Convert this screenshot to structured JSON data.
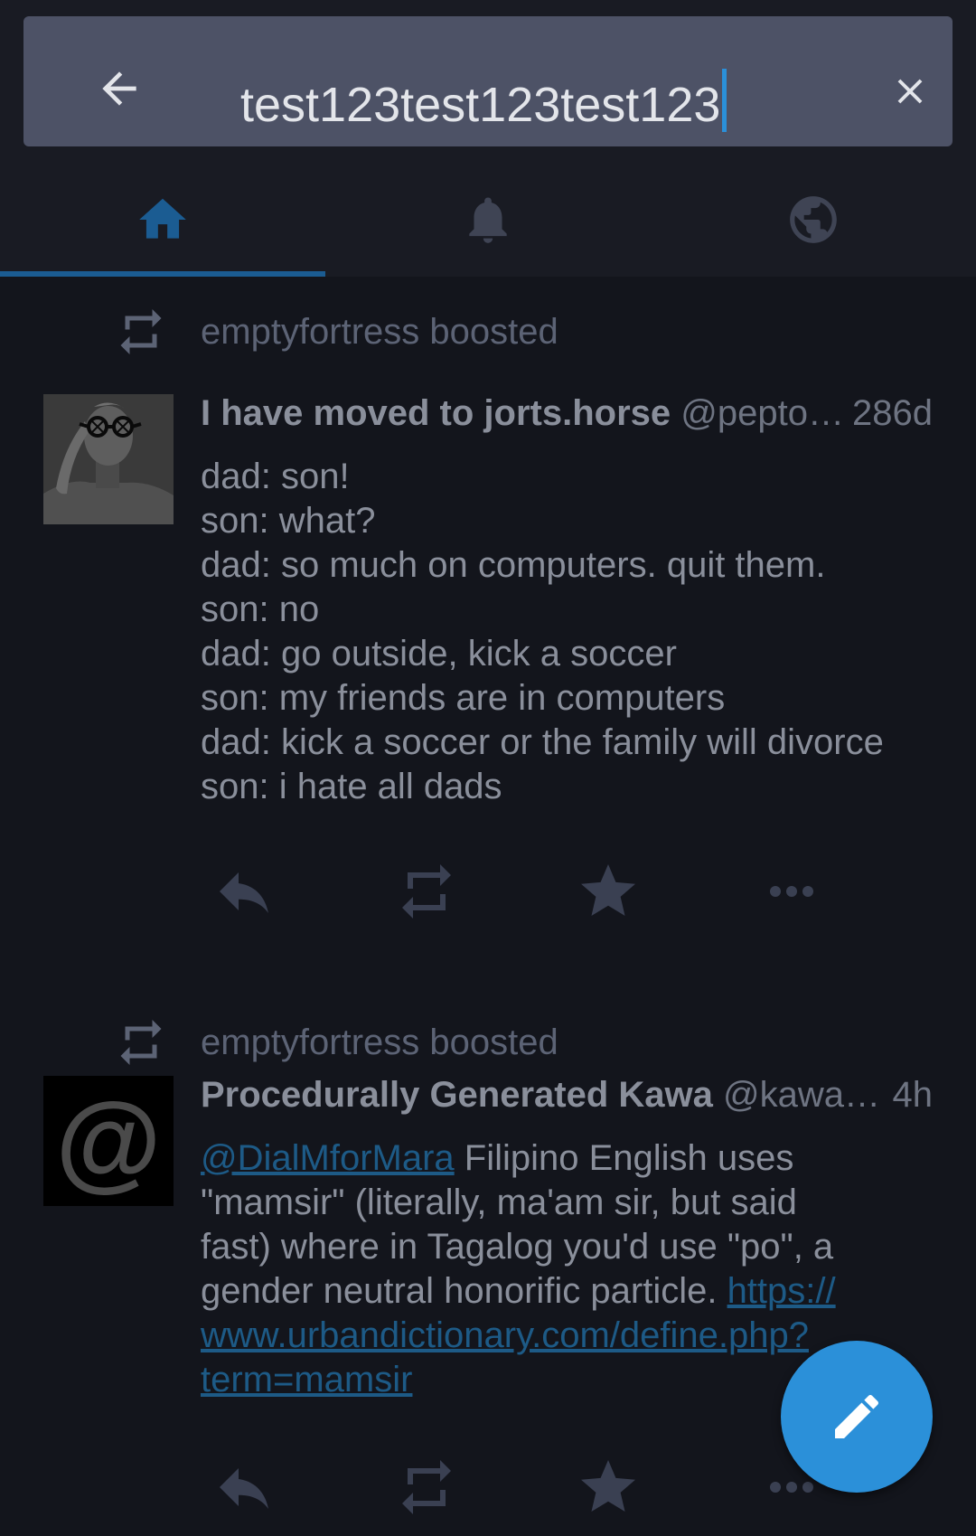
{
  "colors": {
    "accent": "#2b90d9",
    "background": "#13151c",
    "searchbar": "#4d5266",
    "tab_active": "#1b5c92",
    "tab_inactive": "#3f4454",
    "link": "#1d5a86"
  },
  "search": {
    "back_icon": "arrow-left-icon",
    "query": "test123test123test123",
    "clear_icon": "close-icon"
  },
  "tabs": [
    {
      "icon": "home-icon",
      "active": true
    },
    {
      "icon": "bell-icon",
      "active": false
    },
    {
      "icon": "globe-icon",
      "active": false
    }
  ],
  "statuses": [
    {
      "boosted_by": "emptyfortress boosted",
      "display_name": "I have moved to jorts.horse",
      "handle": "@pepto…",
      "time": "286d",
      "content_lines": [
        "dad: son!",
        "son: what?",
        "dad: so much on computers. quit them.",
        "son: no",
        "dad: go outside, kick a soccer",
        "son: my friends are in computers",
        "dad: kick a soccer or the family will divorce",
        "son: i hate all dads"
      ]
    },
    {
      "boosted_by": "emptyfortress boosted",
      "display_name": "Procedurally Generated Kawa",
      "handle": "@kawa…",
      "time": "4h",
      "avatar_text": "@",
      "mention": "@DialMforMara",
      "text_1": " Filipino English uses",
      "line_2": "\"mamsir\" (literally, ma'am sir, but said",
      "line_3": "fast) where in Tagalog you'd use \"po\", a",
      "text_4": "gender neutral honorific particle. ",
      "link_1": "https://",
      "link_2": "www.urbandictionary.com/define.php?",
      "link_3": "term=mamsir"
    }
  ],
  "action_icons": [
    "reply-icon",
    "boost-icon",
    "favourite-icon",
    "more-icon"
  ],
  "fab": {
    "icon": "pencil-icon"
  }
}
